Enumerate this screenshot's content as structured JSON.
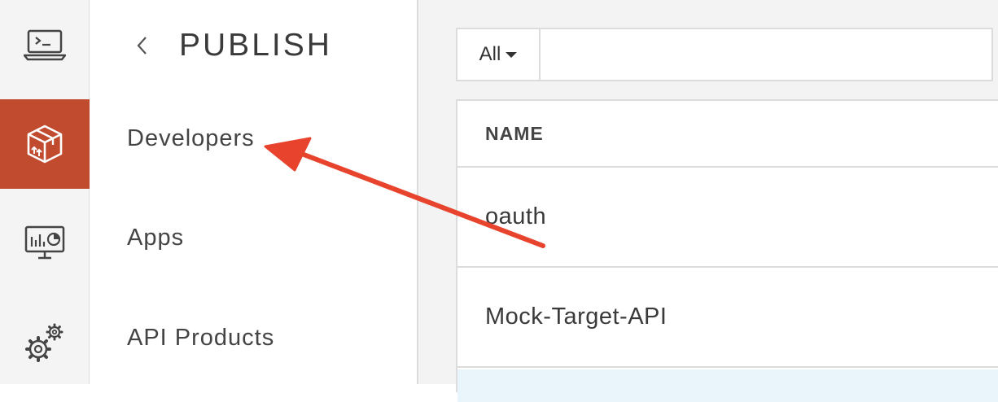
{
  "sidebar": {
    "icons": [
      {
        "name": "console-icon",
        "active": false
      },
      {
        "name": "publish-package-icon",
        "active": true
      },
      {
        "name": "analytics-monitor-icon",
        "active": false
      },
      {
        "name": "settings-gears-icon",
        "active": false
      }
    ],
    "active_color": "#c14b2f"
  },
  "subnav": {
    "title": "PUBLISH",
    "items": [
      {
        "label": "Developers"
      },
      {
        "label": "Apps"
      },
      {
        "label": "API Products"
      }
    ]
  },
  "filter": {
    "select_value": "All",
    "search_value": ""
  },
  "table": {
    "columns": [
      "NAME"
    ],
    "rows": [
      {
        "name": "oauth"
      },
      {
        "name": "Mock-Target-API"
      }
    ]
  },
  "annotation": {
    "color": "#e8432d"
  }
}
